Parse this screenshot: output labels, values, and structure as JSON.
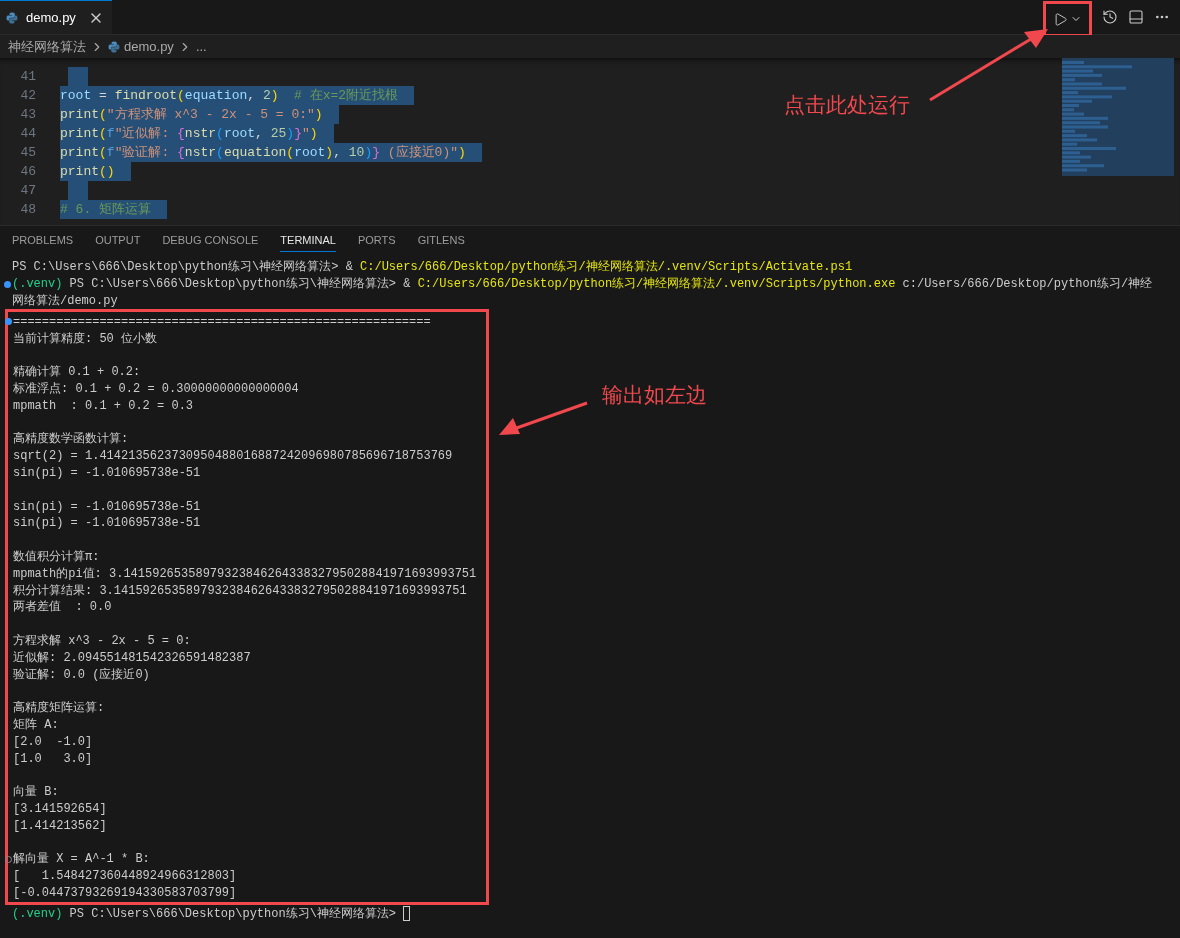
{
  "editor_tab": {
    "label": "demo.py",
    "selected": true
  },
  "breadcrumb": {
    "folder": "神经网络算法",
    "file": "demo.py",
    "more": "..."
  },
  "editor": {
    "lines": [
      {
        "number": "41",
        "selected": true
      },
      {
        "number": "42",
        "selected": true,
        "segments": [
          {
            "text": "root",
            "kind": "v"
          },
          {
            "text": " = ",
            "kind": "p"
          },
          {
            "text": "findroot",
            "kind": "f"
          },
          {
            "text": "(",
            "kind": "b1"
          },
          {
            "text": "equation",
            "kind": "v"
          },
          {
            "text": ", ",
            "kind": "p"
          },
          {
            "text": "2",
            "kind": "n"
          },
          {
            "text": ")",
            "kind": "b1"
          },
          {
            "text": "  # 在x=2附近找根",
            "kind": "c"
          }
        ]
      },
      {
        "number": "43",
        "selected": true,
        "segments": [
          {
            "text": "print",
            "kind": "f"
          },
          {
            "text": "(",
            "kind": "b1"
          },
          {
            "text": "\"方程求解 x^3 - 2x - 5 = 0:\"",
            "kind": "s"
          },
          {
            "text": ")",
            "kind": "b1"
          }
        ]
      },
      {
        "number": "44",
        "selected": true,
        "segments": [
          {
            "text": "print",
            "kind": "f"
          },
          {
            "text": "(",
            "kind": "b1"
          },
          {
            "text": "f",
            "kind": "k"
          },
          {
            "text": "\"近似解: ",
            "kind": "s"
          },
          {
            "text": "{",
            "kind": "b2"
          },
          {
            "text": "nstr",
            "kind": "f"
          },
          {
            "text": "(",
            "kind": "b3"
          },
          {
            "text": "root",
            "kind": "v"
          },
          {
            "text": ", ",
            "kind": "p"
          },
          {
            "text": "25",
            "kind": "n"
          },
          {
            "text": ")",
            "kind": "b3"
          },
          {
            "text": "}",
            "kind": "b2"
          },
          {
            "text": "\"",
            "kind": "s"
          },
          {
            "text": ")",
            "kind": "b1"
          }
        ]
      },
      {
        "number": "45",
        "selected": true,
        "segments": [
          {
            "text": "print",
            "kind": "f"
          },
          {
            "text": "(",
            "kind": "b1"
          },
          {
            "text": "f",
            "kind": "k"
          },
          {
            "text": "\"验证解: ",
            "kind": "s"
          },
          {
            "text": "{",
            "kind": "b2"
          },
          {
            "text": "nstr",
            "kind": "f"
          },
          {
            "text": "(",
            "kind": "b3"
          },
          {
            "text": "equation",
            "kind": "f"
          },
          {
            "text": "(",
            "kind": "b1"
          },
          {
            "text": "root",
            "kind": "v"
          },
          {
            "text": ")",
            "kind": "b1"
          },
          {
            "text": ", ",
            "kind": "p"
          },
          {
            "text": "10",
            "kind": "n"
          },
          {
            "text": ")",
            "kind": "b3"
          },
          {
            "text": "}",
            "kind": "b2"
          },
          {
            "text": " (应接近0)\"",
            "kind": "s"
          },
          {
            "text": ")",
            "kind": "b1"
          }
        ]
      },
      {
        "number": "46",
        "selected": true,
        "segments": [
          {
            "text": "print",
            "kind": "f"
          },
          {
            "text": "()",
            "kind": "b1"
          }
        ]
      },
      {
        "number": "47",
        "selected": true
      },
      {
        "number": "48",
        "selected": true,
        "segments": [
          {
            "text": "# 6. 矩阵运算",
            "kind": "c"
          }
        ]
      }
    ]
  },
  "panel_tabs": [
    {
      "label": "PROBLEMS",
      "selected": false
    },
    {
      "label": "OUTPUT",
      "selected": false
    },
    {
      "label": "DEBUG CONSOLE",
      "selected": false
    },
    {
      "label": "TERMINAL",
      "selected": true
    },
    {
      "label": "PORTS",
      "selected": false
    },
    {
      "label": "GITLENS",
      "selected": false
    }
  ],
  "terminal": {
    "header_lines": [
      {
        "segments": [
          {
            "text": "PS C:\\Users\\666\\Desktop\\python练习\\神经网络算法> & ",
            "kind": "plain"
          },
          {
            "text": "C:/Users/666/Desktop/python练习/神经网络算法/.venv/Scripts/Activate.ps1",
            "kind": "path"
          }
        ]
      },
      {
        "kind": "dot",
        "segments": [
          {
            "text": "(.venv)",
            "kind": "venv"
          },
          {
            "text": " PS C:\\Users\\666\\Desktop\\python练习\\神经网络算法> & ",
            "kind": "plain"
          },
          {
            "text": "C:/Users/666/Desktop/python练习/神经网络算法/.venv/Scripts/python.exe",
            "kind": "path"
          },
          {
            "text": " c:/Users/666/Desktop/python练习/神经",
            "kind": "plain"
          }
        ]
      },
      {
        "segments": [
          {
            "text": "网络算法/demo.py",
            "kind": "plain"
          }
        ]
      }
    ],
    "output_blocks": [
      [
        {
          "text": "==========================================================",
          "kind": "dot"
        },
        {
          "text": "当前计算精度: 50 位小数"
        }
      ],
      [
        {
          "text": "精确计算 0.1 + 0.2:"
        },
        {
          "text": "标准浮点: 0.1 + 0.2 = 0.30000000000000004"
        },
        {
          "text": "mpmath  : 0.1 + 0.2 = 0.3"
        }
      ],
      [
        {
          "text": "高精度数学函数计算:"
        },
        {
          "text": "sqrt(2) = 1.4142135623730950488016887242096980785696718753769"
        },
        {
          "text": "sin(pi) = -1.010695738e-51"
        }
      ],
      [
        {
          "text": "sin(pi) = -1.010695738e-51"
        },
        {
          "text": "sin(pi) = -1.010695738e-51"
        }
      ],
      [
        {
          "text": "数值积分计算π:"
        },
        {
          "text": "mpmath的pi值: 3.1415926535897932384626433832795028841971693993751"
        },
        {
          "text": "积分计算结果: 3.1415926535897932384626433832795028841971693993751"
        },
        {
          "text": "两者差值  : 0.0"
        }
      ],
      [
        {
          "text": "方程求解 x^3 - 2x - 5 = 0:"
        },
        {
          "text": "近似解: 2.094551481542326591482387"
        },
        {
          "text": "验证解: 0.0 (应接近0)"
        }
      ],
      [
        {
          "text": "高精度矩阵运算:"
        },
        {
          "text": "矩阵 A:"
        },
        {
          "text": "[2.0  -1.0]"
        },
        {
          "text": "[1.0   3.0]"
        }
      ],
      [
        {
          "text": "向量 B:"
        },
        {
          "text": "[3.141592654]"
        },
        {
          "text": "[1.414213562]"
        }
      ],
      [
        {
          "text": "解向量 X = A^-1 * B:",
          "kind": "ring"
        },
        {
          "text": "[   1.548427360448924966312803]"
        },
        {
          "text": "[-0.04473793269194330583703799]"
        }
      ]
    ],
    "prompt_line": {
      "segments": [
        {
          "text": "(.venv)",
          "kind": "venv"
        },
        {
          "text": " PS C:\\Users\\666\\Desktop\\python练习\\神经网络算法> ",
          "kind": "plain"
        }
      ]
    }
  },
  "annotations": [
    {
      "text": "点击此处运行"
    },
    {
      "text": "输出如左边"
    }
  ]
}
